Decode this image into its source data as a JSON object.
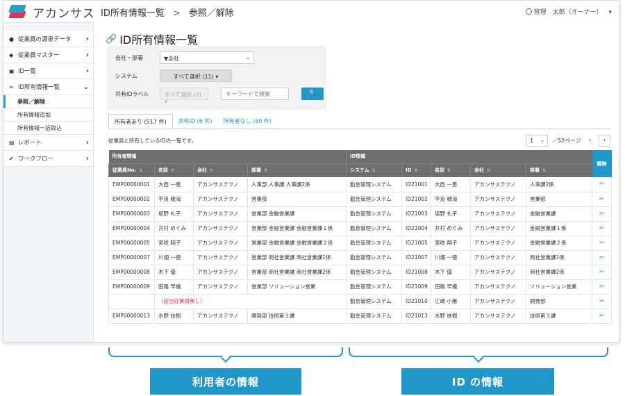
{
  "app": {
    "logo_text": "アカンサス",
    "breadcrumb": [
      "ID所有情報一覧",
      "参照／解除"
    ],
    "breadcrumb_sep": ">",
    "user": "管理　太郎（オーナー）",
    "user_caret": "▾"
  },
  "sidebar": {
    "items": [
      {
        "icon": "person-icon",
        "label": "従業員の源泉データ"
      },
      {
        "icon": "group-icon",
        "label": "従業員マスター"
      },
      {
        "icon": "id-card-icon",
        "label": "ID一覧"
      },
      {
        "icon": "link-icon",
        "label": "ID所有情報一覧"
      }
    ],
    "subitems": [
      "参照／解除",
      "所有情報追加",
      "所有情報一括取込"
    ],
    "items2": [
      {
        "icon": "document-icon",
        "label": "レポート"
      },
      {
        "icon": "check-icon",
        "label": "ワークフロー"
      }
    ]
  },
  "main": {
    "title": "ID所有情報一覧",
    "filter": {
      "company_label": "会社・部署",
      "company_value": "▼全社",
      "system_label": "システム",
      "system_value": "すべて選択 (11) ▾",
      "shared_label": "共有IDラベル",
      "shared_value": "すべて選択 (3) ▾",
      "keyword_placeholder": "キーワードで検索",
      "search_label": "🔍"
    },
    "tabs": [
      "所有者あり (517 件)",
      "共有ID (6 件)",
      "所有者なし (60 件)"
    ],
    "description": "従業員と所有しているIDの一覧です。",
    "pager": {
      "page": "1",
      "total": "／52ページ",
      "prev": "‹",
      "next": "›"
    },
    "group_owner": "所有者情報",
    "group_id": "ID情報",
    "action_header": "解除",
    "columns": [
      "従業員No.",
      "名前",
      "会社",
      "部署",
      "システム",
      "ID",
      "名前",
      "会社",
      "部署"
    ],
    "rows": [
      [
        "EMP00000001",
        "大西 一恵",
        "アカンサステクノ",
        "人事部 人事課 人事課2係",
        "勤怠管理システム",
        "ID21001",
        "大西 一恵",
        "アカンサステクノ",
        "人事課2係"
      ],
      [
        "EMP00000002",
        "平良 穂海",
        "アカンサステクノ",
        "営業部",
        "勤怠管理システム",
        "ID21002",
        "平良 穂海",
        "アカンサステクノ",
        "営業部"
      ],
      [
        "EMP00000003",
        "坂野 礼子",
        "アカンサステクノ",
        "営業部 金融営業課",
        "勤怠管理システム",
        "ID21003",
        "坂野 礼子",
        "アカンサステクノ",
        "金融営業課"
      ],
      [
        "EMP00000004",
        "井村 めぐみ",
        "アカンサステクノ",
        "営業部 金融営業課 金融営業課１係",
        "勤怠管理システム",
        "ID21004",
        "井村 めぐみ",
        "アカンサステクノ",
        "金融営業課１係"
      ],
      [
        "EMP00000005",
        "宮咲 翔子",
        "アカンサステクノ",
        "営業部 金融営業課 金融営業課２係",
        "勤怠管理システム",
        "ID21005",
        "宮咲 翔子",
        "アカンサステクノ",
        "金融営業課２係"
      ],
      [
        "EMP00000007",
        "川畑 一徳",
        "アカンサステクノ",
        "営業部 商社営業課 商社営業課1係",
        "勤怠管理システム",
        "ID21007",
        "川畑 一徳",
        "アカンサステクノ",
        "商社営業課1係"
      ],
      [
        "EMP00000008",
        "木下 優",
        "アカンサステクノ",
        "営業部 商社営業課 商社営業課2係",
        "勤怠管理システム",
        "ID21008",
        "木下 優",
        "アカンサステクノ",
        "商社営業課2係"
      ],
      [
        "EMP00000009",
        "田路 早織",
        "アカンサステクノ",
        "営業部 ソリューション営業",
        "勤怠管理システム",
        "ID21009",
        "田路 早織",
        "アカンサステクノ",
        "ソリューション営業"
      ],
      [
        "",
        "（該当従業員無し）",
        "",
        "",
        "勤怠管理システム",
        "ID21010",
        "江崎 小雁",
        "アカンサステクノ",
        "開発部"
      ],
      [
        "EMP00000013",
        "水野 扶樹",
        "アカンサステクノ",
        "開発部 技術第３課",
        "勤怠管理システム",
        "ID21013",
        "水野 扶樹",
        "アカンサステクノ",
        "技術第３課"
      ]
    ],
    "action_icon": "unlink-icon",
    "action_glyph": "✂"
  },
  "annotations": {
    "owner_label": "利用者の情報",
    "id_label": "ID の情報"
  },
  "colors": {
    "accent": "#1f98c8",
    "header_gray": "#6e6e6e",
    "danger": "#e2344f"
  }
}
